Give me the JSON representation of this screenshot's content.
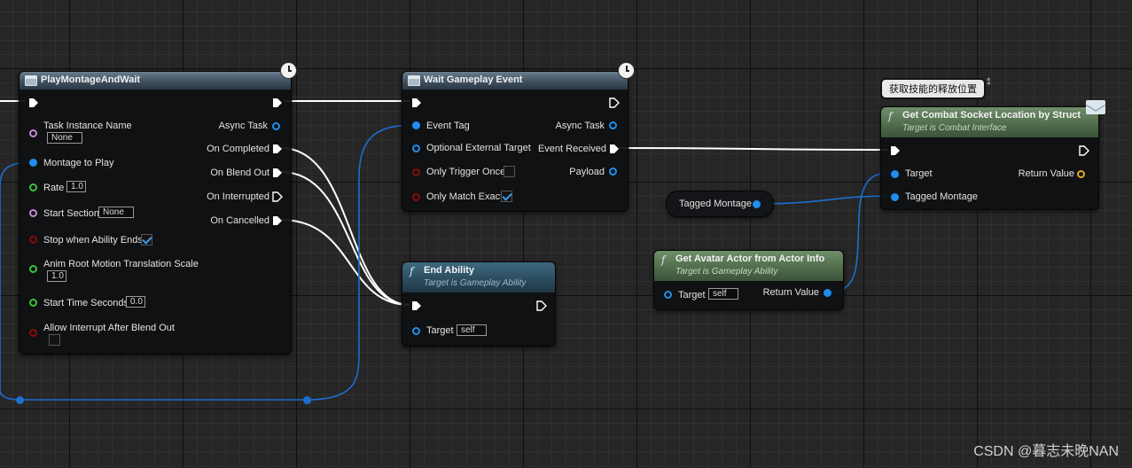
{
  "colors": {
    "exec": "#ffffff",
    "object": "#1e8ff0",
    "float": "#3dc23d",
    "name": "#c58ad8",
    "bool": "#8a0b0b",
    "gameplay_tag": "#1e8ff0",
    "struct": "#e0a91c"
  },
  "nodes": {
    "play_montage": {
      "title": "PlayMontageAndWait",
      "inputs": {
        "task_instance_name": "Task Instance Name",
        "task_instance_name_value": "None",
        "montage_to_play": "Montage to Play",
        "rate": "Rate",
        "rate_value": "1.0",
        "start_section": "Start Section",
        "start_section_value": "None",
        "stop_when_ability_ends": "Stop when Ability Ends",
        "anim_root_motion": "Anim Root Motion Translation Scale",
        "anim_root_motion_value": "1.0",
        "start_time_seconds": "Start Time Seconds",
        "start_time_seconds_value": "0.0",
        "allow_interrupt": "Allow Interrupt After Blend Out"
      },
      "outputs": {
        "async_task": "Async Task",
        "on_completed": "On Completed",
        "on_blend_out": "On Blend Out",
        "on_interrupted": "On Interrupted",
        "on_cancelled": "On Cancelled"
      }
    },
    "wait_gameplay_event": {
      "title": "Wait Gameplay Event",
      "inputs": {
        "event_tag": "Event Tag",
        "optional_external_target": "Optional External Target",
        "only_trigger_once": "Only Trigger Once",
        "only_match_exact": "Only Match Exact"
      },
      "outputs": {
        "async_task": "Async Task",
        "event_received": "Event Received",
        "payload": "Payload"
      }
    },
    "end_ability": {
      "title": "End Ability",
      "subtitle": "Target is Gameplay Ability",
      "target": "Target",
      "target_value": "self"
    },
    "get_combat_socket": {
      "title": "Get Combat Socket Location by Struct",
      "subtitle": "Target is Combat Interface",
      "target": "Target",
      "tagged_montage": "Tagged Montage",
      "return_value": "Return Value",
      "comment": "获取技能的释放位置"
    },
    "get_avatar_actor": {
      "title": "Get Avatar Actor from Actor Info",
      "subtitle": "Target is Gameplay Ability",
      "target": "Target",
      "target_value": "self",
      "return_value": "Return Value"
    },
    "tagged_montage_var": {
      "label": "Tagged Montage"
    }
  },
  "watermark": "CSDN @暮志未晚NAN"
}
